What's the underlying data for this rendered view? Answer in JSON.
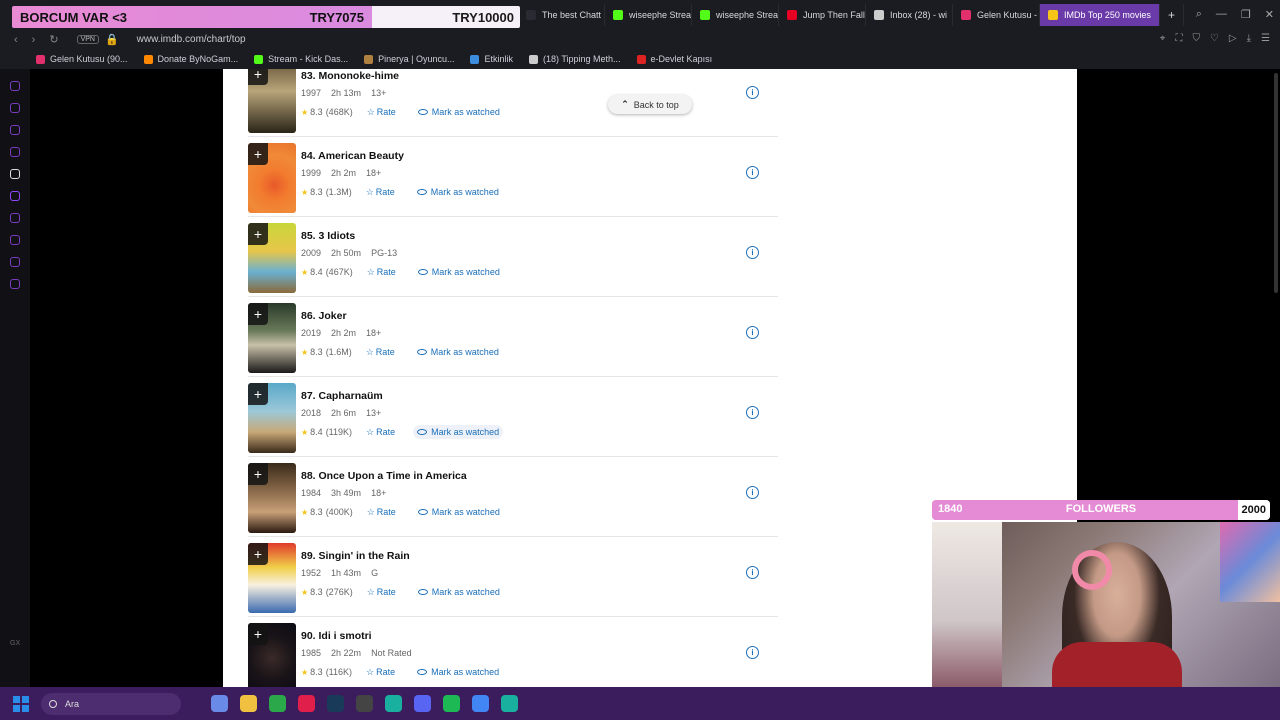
{
  "donation": {
    "left_label": "BORCUM VAR <3",
    "mid_value": "TRY7075",
    "goal_value": "TRY10000"
  },
  "browser": {
    "tabs": [
      {
        "label": "The best Chatt",
        "color": "#2a2a33"
      },
      {
        "label": "wiseephe Strea",
        "color": "#53fc18"
      },
      {
        "label": "wiseephe Strea",
        "color": "#53fc18"
      },
      {
        "label": "Jump Then Fall",
        "color": "#e60023"
      },
      {
        "label": "Inbox (28) - wi",
        "color": "#cccccc"
      },
      {
        "label": "Gelen Kutusu -",
        "color": "#e1306c"
      },
      {
        "label": "IMDb Top 250 movies",
        "color": "#f5c518",
        "active": true
      }
    ],
    "vpn": "VPN",
    "url": "www.imdb.com/chart/top",
    "bookmarks": [
      {
        "label": "Gelen Kutusu (90...",
        "color": "#e1306c"
      },
      {
        "label": "Donate ByNoGam...",
        "color": "#ff8800"
      },
      {
        "label": "Stream - Kick Das...",
        "color": "#53fc18"
      },
      {
        "label": "Pinerya | Oyuncu...",
        "color": "#b08040"
      },
      {
        "label": "Etkinlik",
        "color": "#3c8dde"
      },
      {
        "label": "(18) Tipping Meth...",
        "color": "#cccccc"
      },
      {
        "label": "e-Devlet Kapısı",
        "color": "#d22"
      }
    ]
  },
  "sidebar": {
    "bottom_label": "GX"
  },
  "imdb": {
    "back_to_top": "Back to top",
    "rate_label": "Rate",
    "watch_label": "Mark as watched",
    "movies": [
      {
        "title": "83. Mononoke-hime",
        "year": "1997",
        "duration": "2h 13m",
        "cert": "13+",
        "rating": "8.3",
        "votes": "(468K)",
        "poster": "linear-gradient(180deg,#6b5a3e,#b9a57a 40%,#2a2418)"
      },
      {
        "title": "84. American Beauty",
        "year": "1999",
        "duration": "2h 2m",
        "cert": "18+",
        "rating": "8.3",
        "votes": "(1.3M)",
        "poster": "radial-gradient(circle at 55% 60%,#e85a2a,#f27b2e 30%,#f08a38 60%,#e8702a)"
      },
      {
        "title": "85. 3 Idiots",
        "year": "2009",
        "duration": "2h 50m",
        "cert": "PG-13",
        "rating": "8.4",
        "votes": "(467K)",
        "poster": "linear-gradient(180deg,#c8d63a,#e8c64a 40%,#6ab0d0 70%,#8a6a3a)"
      },
      {
        "title": "86. Joker",
        "year": "2019",
        "duration": "2h 2m",
        "cert": "18+",
        "rating": "8.3",
        "votes": "(1.6M)",
        "poster": "linear-gradient(180deg,#2a3a2a,#6a7a5a 40%,#c8c0a8 60%,#1a1a1a)"
      },
      {
        "title": "87. Capharnaüm",
        "year": "2018",
        "duration": "2h 6m",
        "cert": "13+",
        "rating": "8.4",
        "votes": "(119K)",
        "poster": "linear-gradient(180deg,#5aa8c8,#9ac8d8 40%,#c8a878 70%,#3a2a1a)",
        "hover": true
      },
      {
        "title": "88. Once Upon a Time in America",
        "year": "1984",
        "duration": "3h 49m",
        "cert": "18+",
        "rating": "8.3",
        "votes": "(400K)",
        "poster": "linear-gradient(180deg,#3a2a1a,#8a6a4a 40%,#c8a078 70%,#2a1a10)"
      },
      {
        "title": "89. Singin' in the Rain",
        "year": "1952",
        "duration": "1h 43m",
        "cert": "G",
        "rating": "8.3",
        "votes": "(276K)",
        "poster": "linear-gradient(180deg,#e03a2a,#f0d04a 35%,#f8f0e0 60%,#3a6ab0)"
      },
      {
        "title": "90. Idi i smotri",
        "year": "1985",
        "duration": "2h 22m",
        "cert": "Not Rated",
        "rating": "8.3",
        "votes": "(116K)",
        "poster": "radial-gradient(circle at 50% 50%,#3a2a28,#1a1418 50%,#0a0a14)"
      }
    ]
  },
  "followers": {
    "current": "1840",
    "label": "FOLLOWERS",
    "goal": "2000",
    "progress": 0.92
  },
  "taskbar": {
    "search_placeholder": "Ara",
    "icons": [
      {
        "name": "copilot-icon",
        "color": "#6a8ae8"
      },
      {
        "name": "file-explorer-icon",
        "color": "#f0c040"
      },
      {
        "name": "xbox-icon",
        "color": "#2aa84a"
      },
      {
        "name": "opera-gx-icon",
        "color": "#e0204a"
      },
      {
        "name": "steam-icon",
        "color": "#1a3a5a"
      },
      {
        "name": "obs-icon",
        "color": "#444444"
      },
      {
        "name": "game-app-icon",
        "color": "#1ab0a0"
      },
      {
        "name": "discord-icon",
        "color": "#5865f2"
      },
      {
        "name": "spotify-icon",
        "color": "#1db954"
      },
      {
        "name": "chrome-icon",
        "color": "#4285f4"
      },
      {
        "name": "app-icon",
        "color": "#1ab0a0"
      }
    ]
  }
}
